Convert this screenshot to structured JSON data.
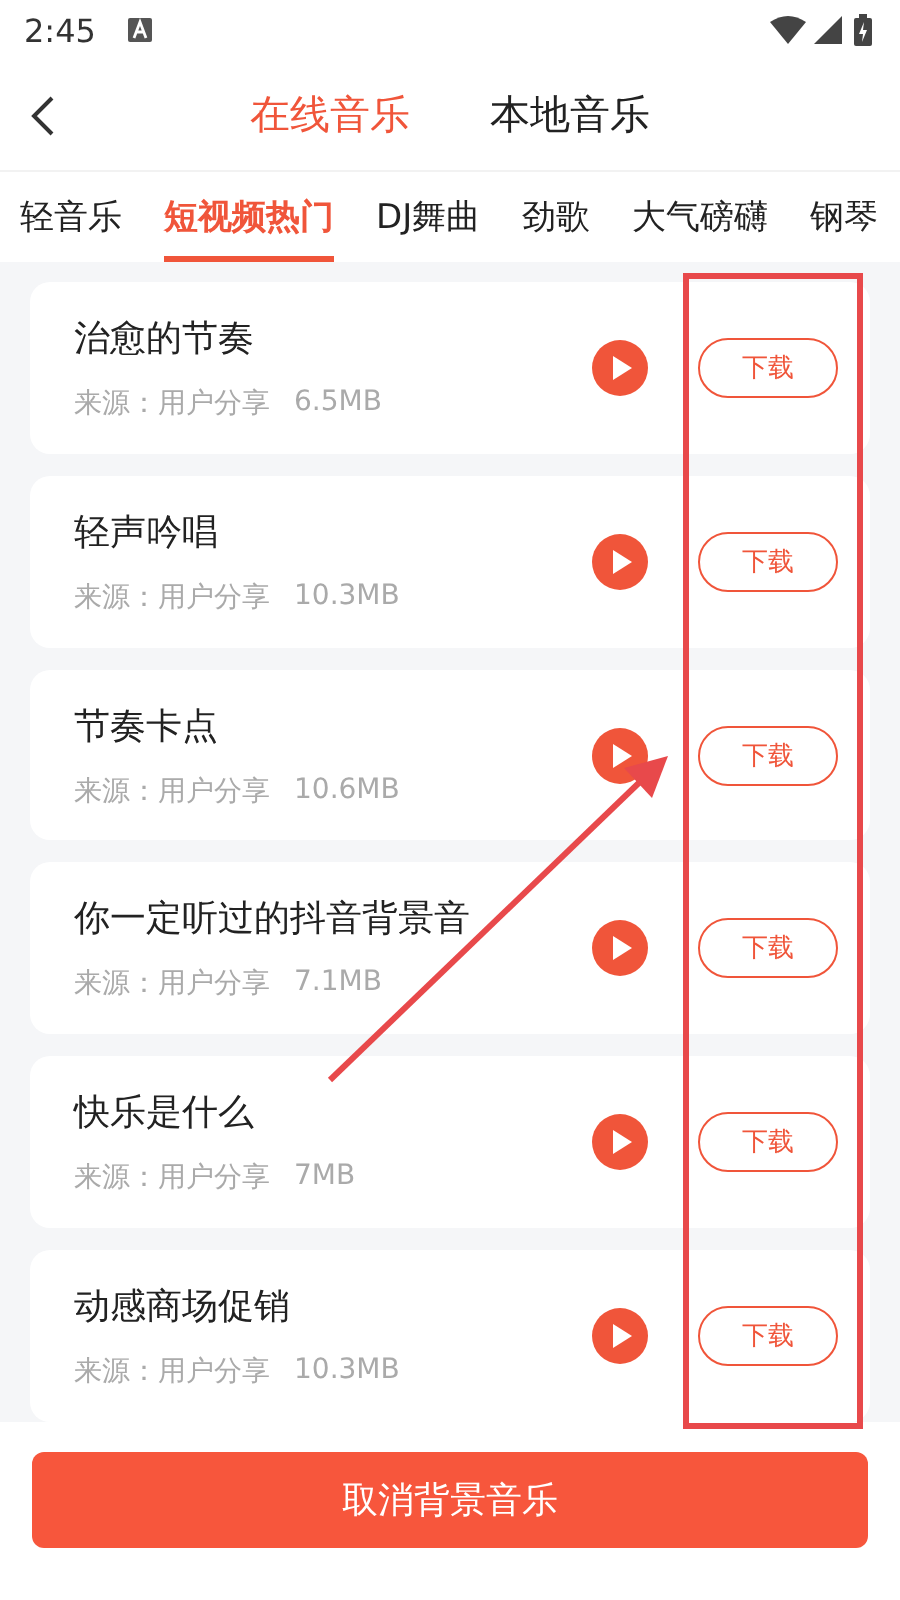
{
  "status_bar": {
    "time": "2:45"
  },
  "header": {
    "tabs": [
      {
        "label": "在线音乐",
        "selected": true
      },
      {
        "label": "本地音乐",
        "selected": false
      }
    ]
  },
  "categories": [
    {
      "label": "轻音乐",
      "selected": false
    },
    {
      "label": "短视频热门",
      "selected": true
    },
    {
      "label": "DJ舞曲",
      "selected": false
    },
    {
      "label": "劲歌",
      "selected": false
    },
    {
      "label": "大气磅礴",
      "selected": false
    },
    {
      "label": "钢琴",
      "selected": false
    }
  ],
  "songs": [
    {
      "title": "治愈的节奏",
      "source": "来源：用户分享",
      "size": "6.5MB",
      "action": "下载"
    },
    {
      "title": "轻声吟唱",
      "source": "来源：用户分享",
      "size": "10.3MB",
      "action": "下载"
    },
    {
      "title": "节奏卡点",
      "source": "来源：用户分享",
      "size": "10.6MB",
      "action": "下载"
    },
    {
      "title": "你一定听过的抖音背景音",
      "source": "来源：用户分享",
      "size": "7.1MB",
      "action": "下载"
    },
    {
      "title": "快乐是什么",
      "source": "来源：用户分享",
      "size": "7MB",
      "action": "下载"
    },
    {
      "title": "动感商场促销",
      "source": "来源：用户分享",
      "size": "10.3MB",
      "action": "下载"
    }
  ],
  "bottom_button": {
    "label": "取消背景音乐"
  }
}
